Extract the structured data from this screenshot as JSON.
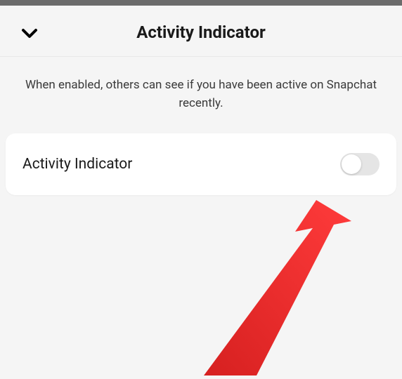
{
  "header": {
    "title": "Activity Indicator"
  },
  "description": {
    "text": "When enabled, others can see if you have been active on Snapchat recently."
  },
  "setting": {
    "label": "Activity Indicator",
    "enabled": false
  }
}
